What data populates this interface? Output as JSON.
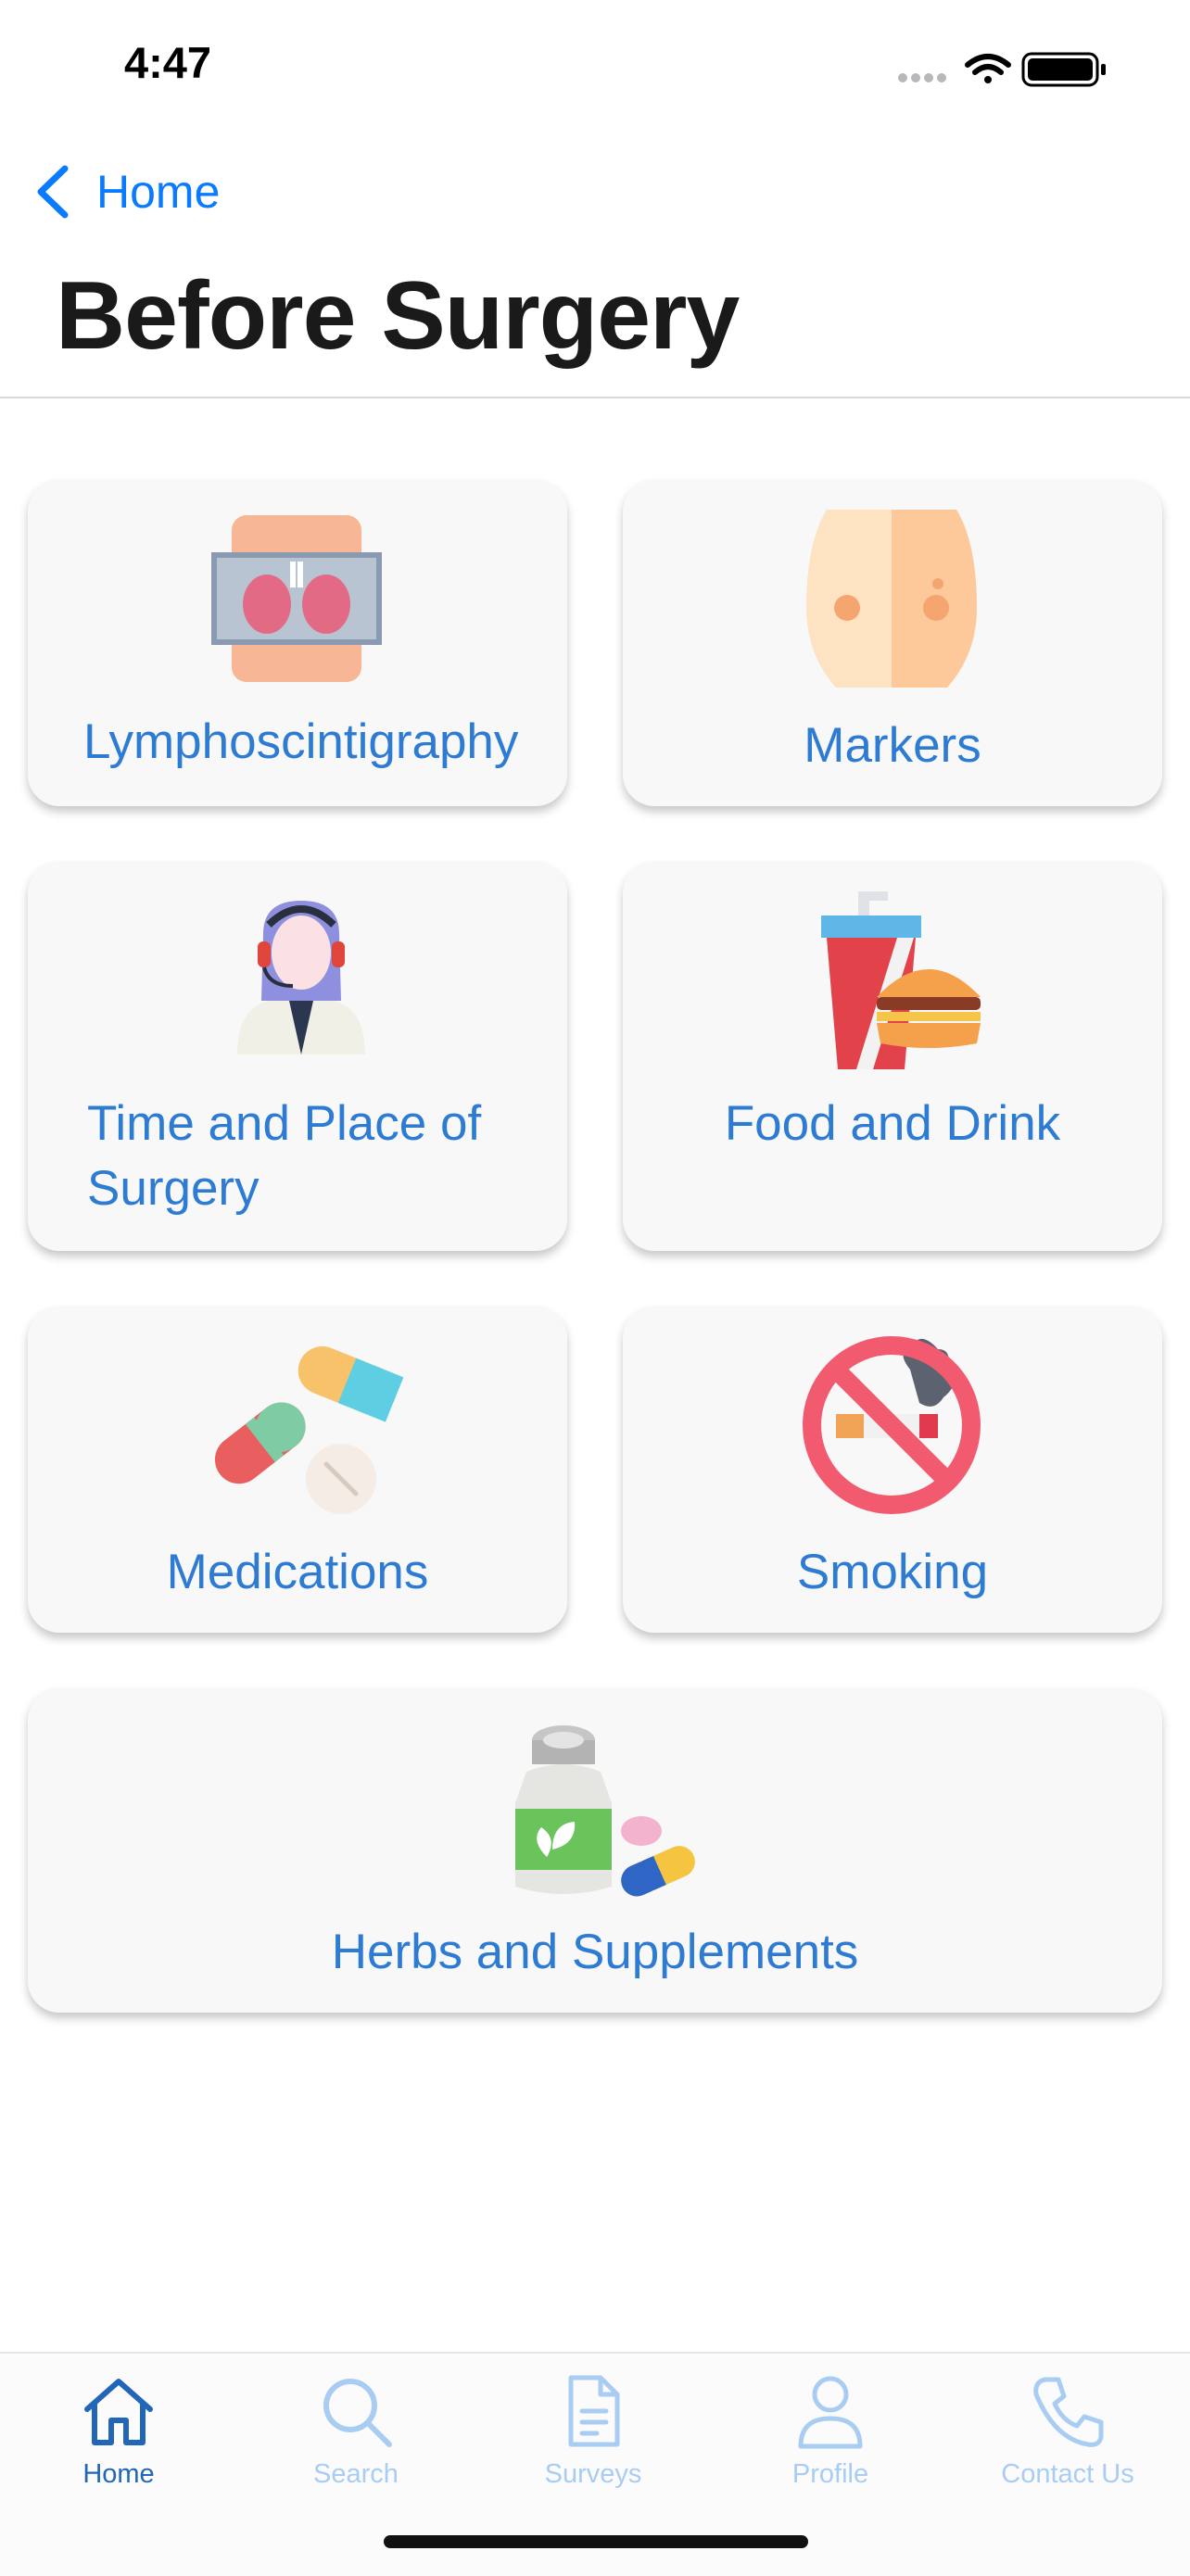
{
  "status_bar": {
    "time": "4:47"
  },
  "nav": {
    "back_label": "Home",
    "title": "Before Surgery"
  },
  "cards": [
    {
      "label": "Lymphoscintigraphy"
    },
    {
      "label": "Markers"
    },
    {
      "label": "Time and Place of Surgery"
    },
    {
      "label": "Food and Drink"
    },
    {
      "label": "Medications"
    },
    {
      "label": "Smoking"
    },
    {
      "label": "Herbs and Supplements"
    }
  ],
  "tabs": [
    {
      "label": "Home",
      "active": true
    },
    {
      "label": "Search",
      "active": false
    },
    {
      "label": "Surveys",
      "active": false
    },
    {
      "label": "Profile",
      "active": false
    },
    {
      "label": "Contact Us",
      "active": false
    }
  ],
  "colors": {
    "accent": "#0a7aff",
    "card_text": "#2d7bd2",
    "tab_active": "#2166b7",
    "tab_inactive": "#a9cdf2",
    "card_bg": "#f8f8f8"
  }
}
